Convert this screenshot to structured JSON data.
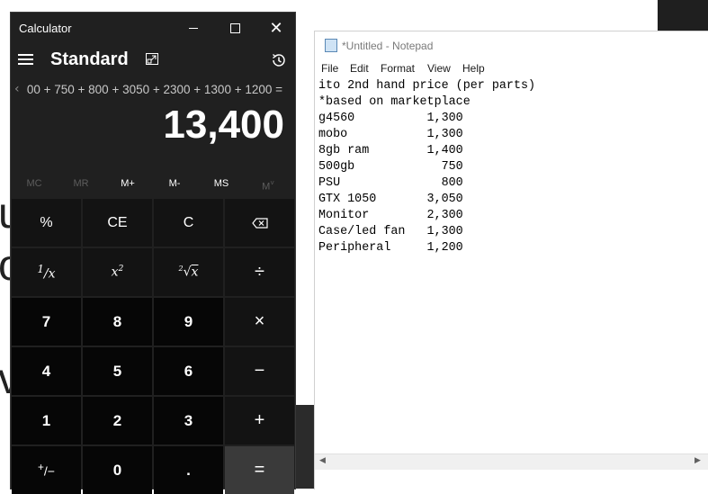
{
  "calculator": {
    "window_title": "Calculator",
    "mode": "Standard",
    "expression": "00 + 750 + 800 + 3050 + 2300 + 1300 + 1200 =",
    "display": "13,400",
    "memory": {
      "mc": "MC",
      "mr": "MR",
      "m_plus": "M+",
      "m_minus": "M-",
      "ms": "MS",
      "m_list": "M"
    },
    "keys": {
      "percent": "%",
      "ce": "CE",
      "c": "C",
      "reciprocal_one": "1",
      "reciprocal_x": "x",
      "square_x": "x",
      "square_exp": "2",
      "root_index": "2",
      "root_x": "x",
      "divide": "÷",
      "seven": "7",
      "eight": "8",
      "nine": "9",
      "multiply": "×",
      "four": "4",
      "five": "5",
      "six": "6",
      "minus": "−",
      "one": "1",
      "two": "2",
      "three": "3",
      "plus": "+",
      "negate_plus": "+",
      "negate_minus": "/−",
      "zero": "0",
      "decimal": ".",
      "equals": "="
    }
  },
  "notepad": {
    "window_title": "*Untitled - Notepad",
    "menu": [
      "File",
      "Edit",
      "Format",
      "View",
      "Help"
    ],
    "lines": [
      "ito 2nd hand price (per parts)",
      "*based on marketplace",
      "g4560          1,300",
      "mobo           1,300",
      "8gb ram        1,400",
      "500gb            750",
      "PSU              800",
      "GTX 1050       3,050",
      "Monitor        2,300",
      "Case/led fan   1,300",
      "Peripheral     1,200"
    ]
  },
  "background": {
    "glyphs": [
      "u",
      "o",
      "v"
    ]
  },
  "colors": {
    "calc_bg": "#202020",
    "num_key": "#060606",
    "fn_key": "#131313",
    "equals_key": "#3a3a3a",
    "notepad_bg": "#ffffff"
  },
  "icons": {
    "menu": "hamburger-icon",
    "keep_on_top": "keep-on-top-icon",
    "history": "history-icon",
    "backspace": "backspace-icon",
    "notepad": "notepad-icon"
  }
}
